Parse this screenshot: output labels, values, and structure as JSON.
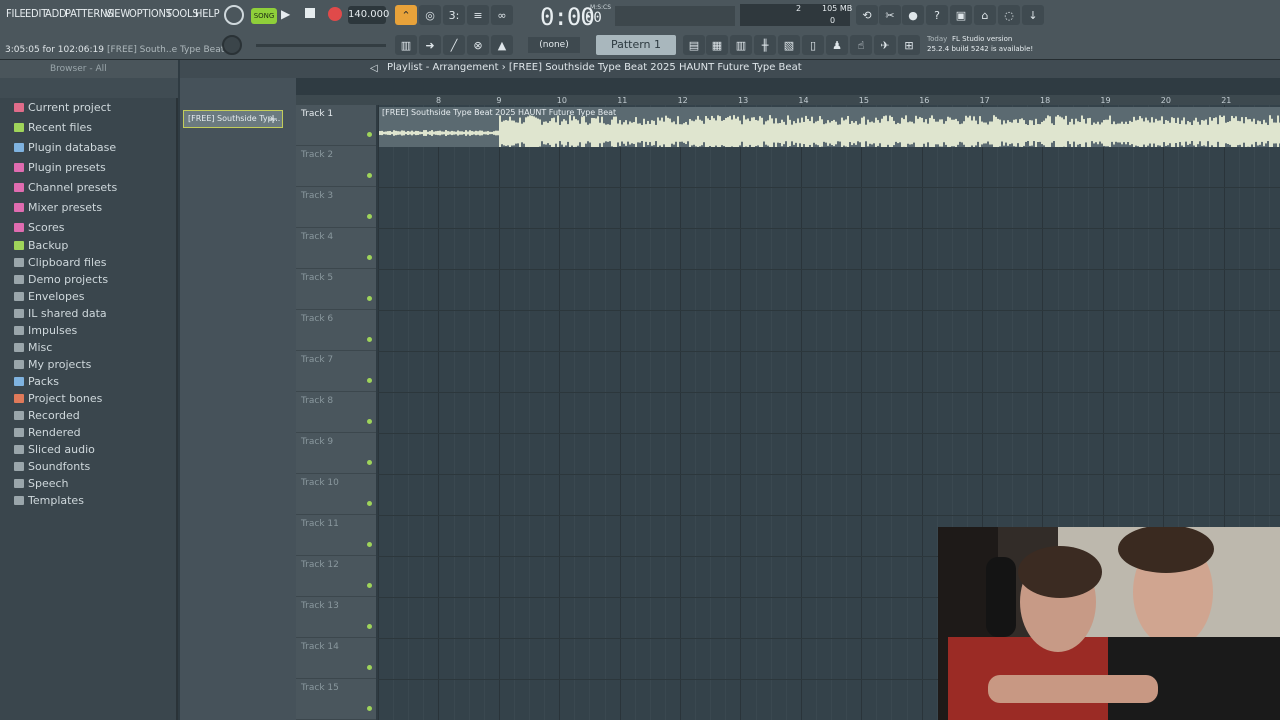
{
  "menu": [
    "FILE",
    "EDIT",
    "ADD",
    "PATTERNS",
    "VIEW",
    "OPTIONS",
    "TOOLS",
    "HELP"
  ],
  "transport": {
    "mode": "SONG",
    "tempo": "140.000",
    "time": "0:00",
    "time_sub": "00",
    "time_unit": "M:S:CS",
    "cpu_label": "105 MB",
    "cpu_value": "0",
    "counter_a": "2",
    "pattern_none": "(none)",
    "pattern": "Pattern 1"
  },
  "hint": {
    "time": "3:05:05 for 102:06:19",
    "name": "[FREE] South..e Type Beat"
  },
  "news": {
    "date": "Today",
    "line1": "FL Studio version",
    "line2": "25.2.4 build 5242 is available!"
  },
  "browser": {
    "title": "Browser - All",
    "items": [
      {
        "label": "Current project",
        "color": "#e06c8a"
      },
      {
        "label": "Recent files",
        "color": "#9fd45a"
      },
      {
        "label": "Plugin database",
        "color": "#7fb3e0"
      },
      {
        "label": "Plugin presets",
        "color": "#e06cb0"
      },
      {
        "label": "Channel presets",
        "color": "#e06cb0"
      },
      {
        "label": "Mixer presets",
        "color": "#e06cb0"
      },
      {
        "label": "Scores",
        "color": "#e06cb0"
      },
      {
        "label": "Backup",
        "color": "#9fd45a"
      },
      {
        "label": "Clipboard files",
        "color": "#9aa6ab"
      },
      {
        "label": "Demo projects",
        "color": "#9aa6ab"
      },
      {
        "label": "Envelopes",
        "color": "#9aa6ab"
      },
      {
        "label": "IL shared data",
        "color": "#9aa6ab"
      },
      {
        "label": "Impulses",
        "color": "#9aa6ab"
      },
      {
        "label": "Misc",
        "color": "#9aa6ab"
      },
      {
        "label": "My projects",
        "color": "#9aa6ab"
      },
      {
        "label": "Packs",
        "color": "#7fb3e0"
      },
      {
        "label": "Project bones",
        "color": "#e07a5a"
      },
      {
        "label": "Recorded",
        "color": "#9aa6ab"
      },
      {
        "label": "Rendered",
        "color": "#9aa6ab"
      },
      {
        "label": "Sliced audio",
        "color": "#9aa6ab"
      },
      {
        "label": "Soundfonts",
        "color": "#9aa6ab"
      },
      {
        "label": "Speech",
        "color": "#9aa6ab"
      },
      {
        "label": "Templates",
        "color": "#9aa6ab"
      }
    ]
  },
  "channel": {
    "name": "[FREE] Southside Typ..."
  },
  "playlist": {
    "title": "Playlist - Arrangement",
    "pattern": "[FREE] Southside Type Beat 2025 HAUNT Future Type Beat",
    "clip_title": "[FREE] Southside Type Beat 2025 HAUNT Future Type Beat",
    "ruler": [
      "8",
      "9",
      "10",
      "11",
      "12",
      "13",
      "14",
      "15",
      "16",
      "17",
      "18",
      "19",
      "20",
      "21"
    ],
    "tracks": [
      "Track 1",
      "Track 2",
      "Track 3",
      "Track 4",
      "Track 5",
      "Track 6",
      "Track 7",
      "Track 8",
      "Track 9",
      "Track 10",
      "Track 11",
      "Track 12",
      "Track 13",
      "Track 14",
      "Track 15"
    ]
  }
}
